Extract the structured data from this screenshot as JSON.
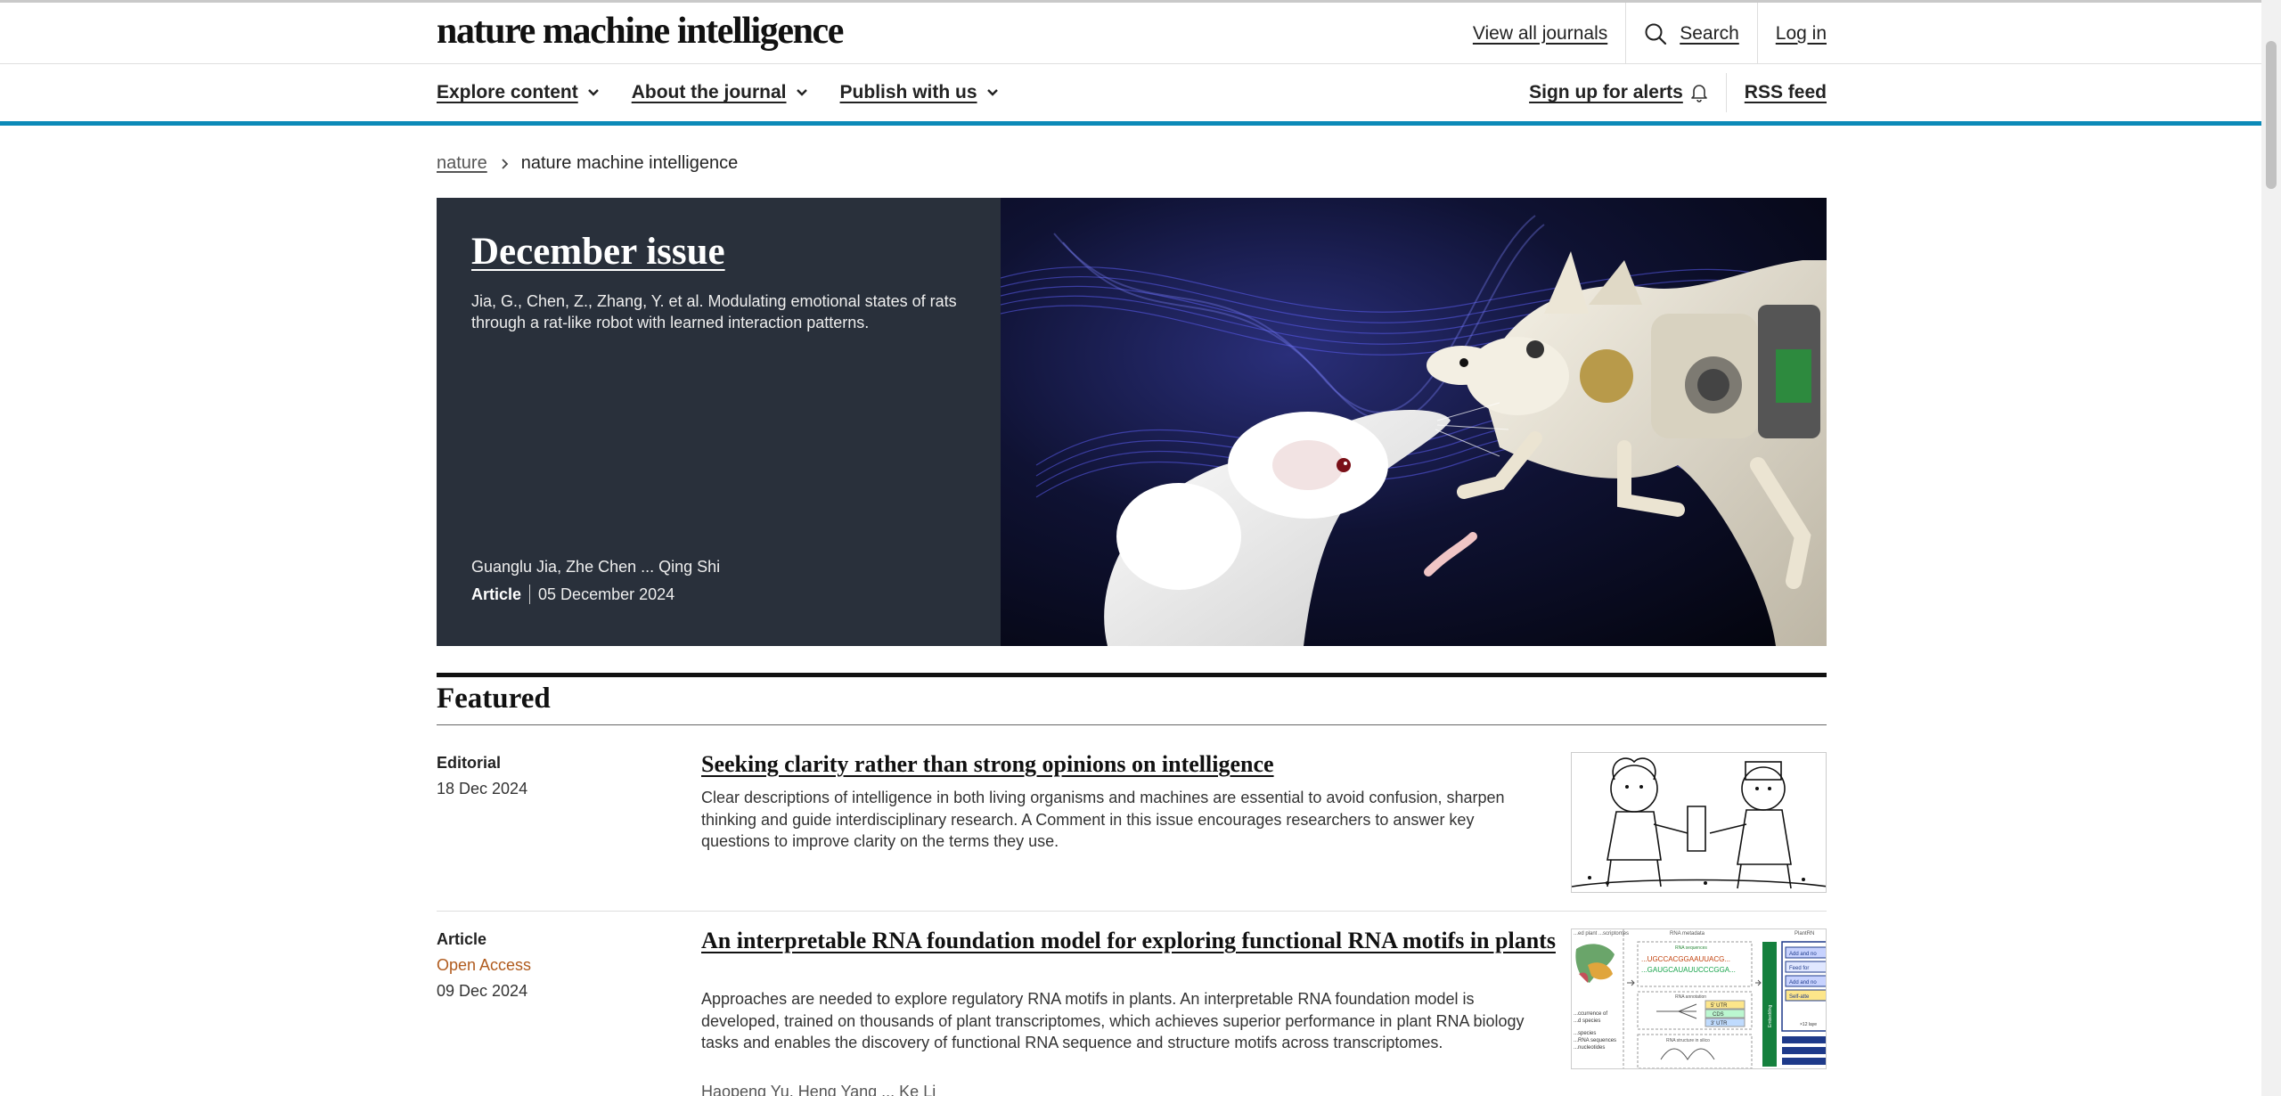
{
  "header": {
    "logo": "nature machine intelligence",
    "links": {
      "journals": "View all journals",
      "search": "Search",
      "login": "Log in"
    }
  },
  "nav": {
    "items": [
      "Explore content",
      "About the journal",
      "Publish with us"
    ],
    "alerts": "Sign up for alerts",
    "rss": "RSS feed"
  },
  "breadcrumb": {
    "root": "nature",
    "current": "nature machine intelligence"
  },
  "hero": {
    "title": "December issue",
    "description": "Jia, G., Chen, Z., Zhang, Y. et al. Modulating emotional states of rats through a rat-like robot with learned interaction patterns.",
    "authors": "Guanglu Jia, Zhe Chen ... Qing Shi",
    "type": "Article",
    "date": "05 December 2024"
  },
  "featured": {
    "heading": "Featured",
    "articles": [
      {
        "type": "Editorial",
        "date": "18 Dec 2024",
        "title": "Seeking clarity rather than strong opinions on intelligence",
        "description": "Clear descriptions of intelligence in both living organisms and machines are essential to avoid confusion, sharpen thinking and guide interdisciplinary research. A Comment in this issue encourages researchers to answer key questions to improve clarity on the terms they use."
      },
      {
        "type": "Article",
        "access": "Open Access",
        "date": "09 Dec 2024",
        "title": "An interpretable RNA foundation model for exploring functional RNA motifs in plants",
        "description": "Approaches are needed to explore regulatory RNA motifs in plants. An interpretable RNA foundation model is developed, trained on thousands of plant transcriptomes, which achieves superior performance in plant RNA biology tasks and enables the discovery of functional RNA sequence and structure motifs across transcriptomes.",
        "authors": "Haopeng Yu, Heng Yang ... Ke Li",
        "figure_text": {
          "panel1_title": "...ed plant ...scriptomes",
          "panel2_title": "RNA metadata",
          "panel3_title": "PlantRN",
          "seq_label": "RNA sequences",
          "seq1": "...UGCCACGGAAUUACG...",
          "seq2": "...GAUGCAUAUUCCCGGA...",
          "annot_label": "RNA annotation",
          "utr5": "5' UTR",
          "cds": "CDS",
          "utr3": "3' UTR",
          "struct_label": "RNA structure in silico",
          "side_label": "Embedding",
          "btn1": "Add and no",
          "btn2": "Feed for",
          "btn3": "Add and no",
          "btn4": "Self-atte",
          "layers": "×12 laye",
          "left1": "...ccurrence of",
          "left2": "...d species",
          "left3": "...species",
          "left4": "...RNA sequences",
          "left5": "...nucleotides"
        }
      }
    ]
  },
  "colors": {
    "accent": "#0c8ab8",
    "hero_panel": "#29303b",
    "open_access": "#b05b1e"
  },
  "icons": [
    "search-icon",
    "chevron-down-icon",
    "bell-icon",
    "breadcrumb-chevron-icon"
  ]
}
